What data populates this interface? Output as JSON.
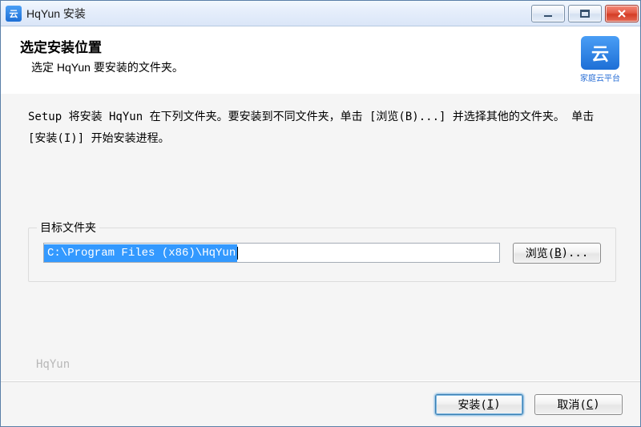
{
  "titlebar": {
    "icon_glyph": "云",
    "title": "HqYun 安装"
  },
  "header": {
    "heading": "选定安装位置",
    "subheading": "选定 HqYun 要安装的文件夹。",
    "logo_glyph": "云",
    "logo_caption": "家庭云平台"
  },
  "body": {
    "instructions": "Setup 将安装 HqYun 在下列文件夹。要安装到不同文件夹，单击 [浏览(B)...] 并选择其他的文件夹。 单击 [安装(I)] 开始安装进程。"
  },
  "destination": {
    "legend": "目标文件夹",
    "path": "C:\\Program Files (x86)\\HqYun",
    "browse_prefix": "浏览(",
    "browse_hotkey": "B",
    "browse_suffix": ")..."
  },
  "footer": {
    "brand": "HqYun",
    "install_prefix": "安装(",
    "install_hotkey": "I",
    "install_suffix": ")",
    "cancel_prefix": "取消(",
    "cancel_hotkey": "C",
    "cancel_suffix": ")"
  }
}
